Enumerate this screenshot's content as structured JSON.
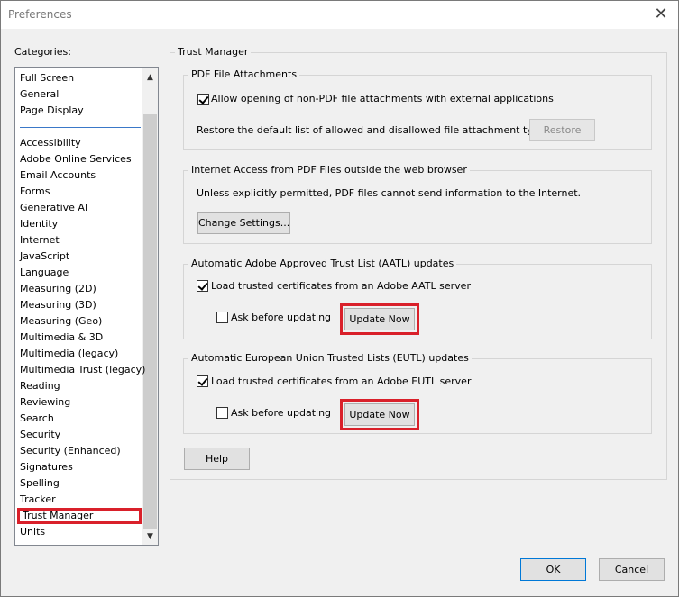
{
  "window": {
    "title": "Preferences",
    "close_glyph": "✕"
  },
  "categories": {
    "label": "Categories:",
    "top_items": [
      "Full Screen",
      "General",
      "Page Display"
    ],
    "items": [
      "Accessibility",
      "Adobe Online Services",
      "Email Accounts",
      "Forms",
      "Generative AI",
      "Identity",
      "Internet",
      "JavaScript",
      "Language",
      "Measuring (2D)",
      "Measuring (3D)",
      "Measuring (Geo)",
      "Multimedia & 3D",
      "Multimedia (legacy)",
      "Multimedia Trust (legacy)",
      "Reading",
      "Reviewing",
      "Search",
      "Security",
      "Security (Enhanced)",
      "Signatures",
      "Spelling",
      "Tracker",
      "Trust Manager",
      "Units"
    ],
    "selected": "Trust Manager",
    "scroll_up_glyph": "▲",
    "scroll_down_glyph": "▼"
  },
  "panel": {
    "title": "Trust Manager"
  },
  "pdf_attachments": {
    "title": "PDF File Attachments",
    "allow_label": "Allow opening of non-PDF file attachments with external applications",
    "allow_checked": true,
    "restore_text": "Restore the default list of allowed and disallowed file attachment types:",
    "restore_button": "Restore"
  },
  "internet_access": {
    "title": "Internet Access from PDF Files outside the web browser",
    "text": "Unless explicitly permitted, PDF files cannot send information to the Internet.",
    "change_button": "Change Settings..."
  },
  "aatl": {
    "title": "Automatic Adobe Approved Trust List (AATL) updates",
    "load_label": "Load trusted certificates from an Adobe AATL server",
    "load_checked": true,
    "ask_label": "Ask before updating",
    "ask_checked": false,
    "update_button": "Update Now"
  },
  "eutl": {
    "title": "Automatic European Union Trusted Lists (EUTL) updates",
    "load_label": "Load trusted certificates from an Adobe EUTL server",
    "load_checked": true,
    "ask_label": "Ask before updating",
    "ask_checked": false,
    "update_button": "Update Now"
  },
  "footer": {
    "help_button": "Help",
    "ok_button": "OK",
    "cancel_button": "Cancel"
  },
  "colors": {
    "highlight": "#d9202a",
    "separator": "#3a78c8"
  }
}
